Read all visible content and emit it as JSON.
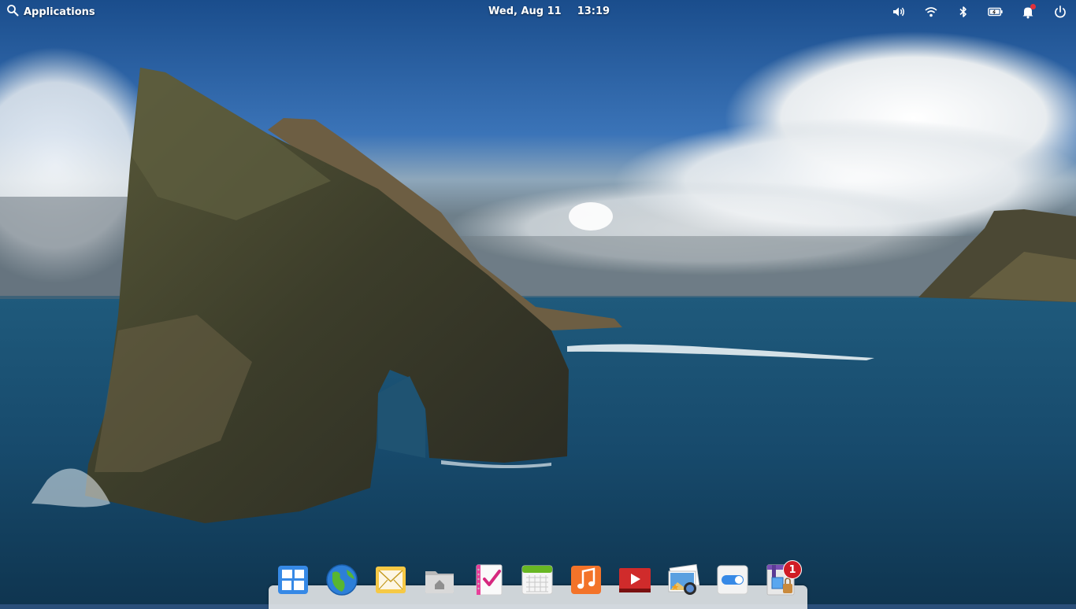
{
  "panel": {
    "applications_label": "Applications",
    "date": "Wed, Aug 11",
    "time": "13:19",
    "indicators": [
      "volume-icon",
      "wifi-icon",
      "bluetooth-icon",
      "battery-icon",
      "notifications-icon",
      "power-icon"
    ]
  },
  "dock": {
    "items": [
      {
        "name": "multitasking-view",
        "icon": "multitasking-icon"
      },
      {
        "name": "web-browser",
        "icon": "globe-icon"
      },
      {
        "name": "mail",
        "icon": "envelope-icon"
      },
      {
        "name": "files",
        "icon": "folder-home-icon"
      },
      {
        "name": "tasks",
        "icon": "checklist-icon"
      },
      {
        "name": "calendar",
        "icon": "calendar-icon"
      },
      {
        "name": "music",
        "icon": "music-note-icon"
      },
      {
        "name": "videos",
        "icon": "play-icon"
      },
      {
        "name": "photos",
        "icon": "photos-icon"
      },
      {
        "name": "system-settings",
        "icon": "toggle-icon"
      },
      {
        "name": "appcenter",
        "icon": "appcenter-icon",
        "badge": "1"
      }
    ]
  },
  "colors": {
    "sky_top": "#1d4f8a",
    "sea": "#173f5e",
    "badge": "#d01c25",
    "accent": "#3689e6"
  }
}
